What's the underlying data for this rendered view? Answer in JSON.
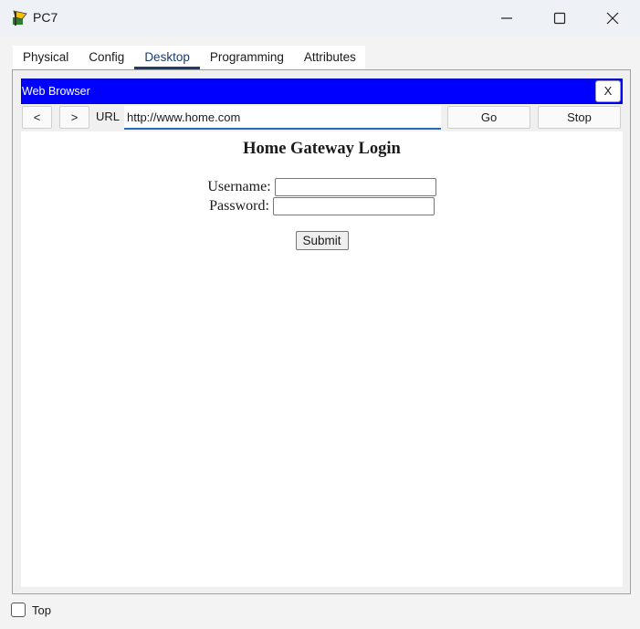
{
  "window": {
    "title": "PC7",
    "icon": "pc-device-icon"
  },
  "tabs": [
    {
      "label": "Physical",
      "active": false
    },
    {
      "label": "Config",
      "active": false
    },
    {
      "label": "Desktop",
      "active": true
    },
    {
      "label": "Programming",
      "active": false
    },
    {
      "label": "Attributes",
      "active": false
    }
  ],
  "browser": {
    "title": "Web Browser",
    "close_label": "X",
    "back_label": "<",
    "forward_label": ">",
    "url_label": "URL",
    "url_value": "http://www.home.com",
    "go_label": "Go",
    "stop_label": "Stop",
    "accent_color": "#0000ff"
  },
  "page": {
    "heading": "Home Gateway Login",
    "username_label": "Username:",
    "username_value": "",
    "password_label": "Password:",
    "password_value": "",
    "submit_label": "Submit"
  },
  "footer": {
    "top_label": "Top",
    "top_checked": false
  }
}
